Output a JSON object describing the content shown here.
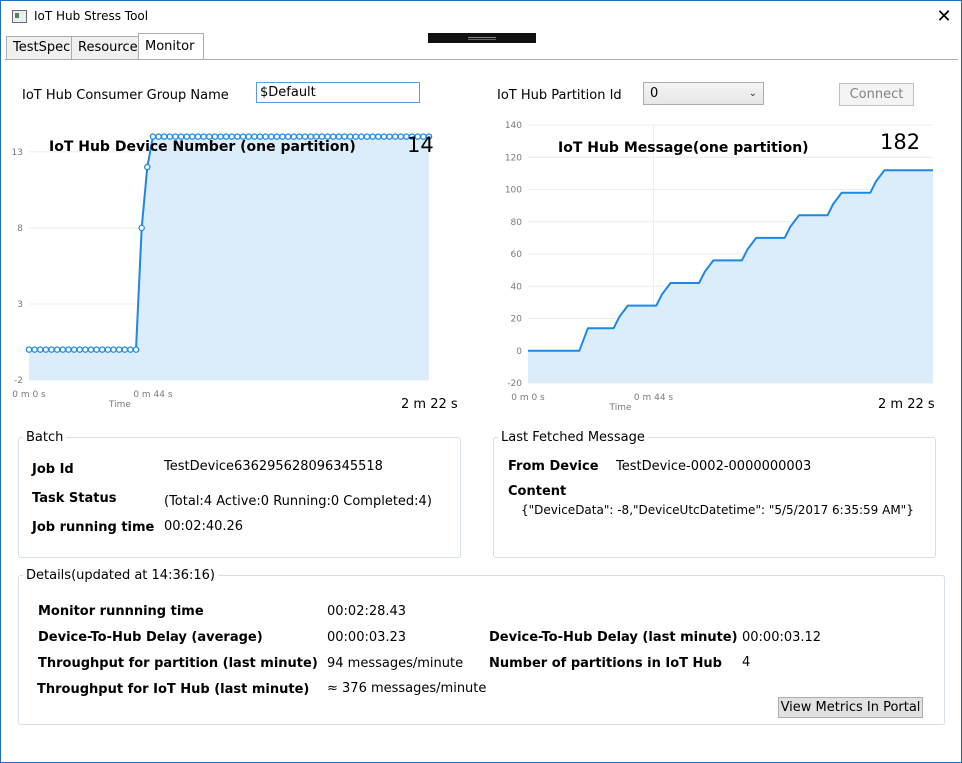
{
  "window": {
    "title": "IoT Hub Stress Tool",
    "close_glyph": "✕"
  },
  "tabs": [
    {
      "label": "TestSpec"
    },
    {
      "label": "Resource"
    },
    {
      "label": "Monitor"
    }
  ],
  "form": {
    "consumer_group_label": "IoT Hub Consumer Group Name",
    "consumer_group_value": "$Default",
    "partition_label": "IoT Hub Partition Id",
    "partition_value": "0",
    "connect_label": "Connect"
  },
  "chart_data": [
    {
      "type": "line",
      "title": "IoT Hub Device Number (one partition)",
      "current_value": "14",
      "xlabel": "Time",
      "x_ticks": [
        "0 m 0 s",
        "0 m 44 s"
      ],
      "x_end_label": "2 m 22 s",
      "ylim": [
        -2,
        14.5
      ],
      "y_ticks": [
        -2,
        3,
        8,
        13
      ],
      "x_range_s": [
        0,
        142
      ],
      "series": [
        {
          "x": [
            0,
            2,
            4,
            6,
            8,
            10,
            12,
            14,
            16,
            18,
            20,
            22,
            24,
            26,
            28,
            30,
            32,
            34,
            36,
            38,
            40,
            42,
            44,
            46,
            48,
            50,
            52,
            54,
            56,
            58,
            60,
            62,
            64,
            66,
            68,
            70,
            72,
            74,
            76,
            78,
            80,
            82,
            84,
            86,
            88,
            90,
            92,
            94,
            96,
            98,
            100,
            102,
            104,
            106,
            108,
            110,
            112,
            114,
            116,
            118,
            120,
            122,
            124,
            126,
            128,
            130,
            132,
            134,
            136,
            138,
            140,
            142
          ],
          "y": [
            0,
            0,
            0,
            0,
            0,
            0,
            0,
            0,
            0,
            0,
            0,
            0,
            0,
            0,
            0,
            0,
            0,
            0,
            0,
            0,
            8,
            12,
            14,
            14,
            14,
            14,
            14,
            14,
            14,
            14,
            14,
            14,
            14,
            14,
            14,
            14,
            14,
            14,
            14,
            14,
            14,
            14,
            14,
            14,
            14,
            14,
            14,
            14,
            14,
            14,
            14,
            14,
            14,
            14,
            14,
            14,
            14,
            14,
            14,
            14,
            14,
            14,
            14,
            14,
            14,
            14,
            14,
            14,
            14,
            14,
            14,
            14
          ]
        }
      ],
      "markers": true
    },
    {
      "type": "area",
      "title": "IoT Hub Message(one partition)",
      "current_value": "182",
      "xlabel": "Time",
      "x_ticks": [
        "0 m 0 s",
        "0 m 44 s"
      ],
      "x_end_label": "2 m 22 s",
      "ylim": [
        -20,
        140
      ],
      "y_ticks": [
        -20,
        0,
        20,
        40,
        60,
        80,
        100,
        120,
        140
      ],
      "x_range_s": [
        0,
        142
      ],
      "series": [
        {
          "x": [
            0,
            18,
            21,
            30,
            32,
            35,
            45,
            47,
            50,
            60,
            62,
            65,
            75,
            77,
            80,
            90,
            92,
            95,
            105,
            107,
            110,
            120,
            122,
            125,
            136,
            138,
            142
          ],
          "y": [
            0,
            0,
            14,
            14,
            21,
            28,
            28,
            35,
            42,
            42,
            49,
            56,
            56,
            63,
            70,
            70,
            77,
            84,
            84,
            91,
            98,
            98,
            105,
            112,
            112,
            112,
            112
          ]
        }
      ]
    }
  ],
  "batch": {
    "title": "Batch",
    "job_id_label": "Job Id",
    "job_id_value": "TestDevice636295628096345518",
    "task_status_label": "Task Status",
    "task_status_value": "(Total:4  Active:0  Running:0  Completed:4)",
    "runtime_label": "Job running time",
    "runtime_value": "00:02:40.26"
  },
  "last_message": {
    "title": "Last Fetched Message",
    "from_label": "From Device",
    "from_value": "TestDevice-0002-0000000003",
    "content_label": "Content",
    "content_value": "{\"DeviceData\": -8,\"DeviceUtcDatetime\": \"5/5/2017 6:35:59 AM\"}"
  },
  "details": {
    "title": "Details(updated at 14:36:16)",
    "monitor_time_label": "Monitor runnning  time",
    "monitor_time_value": "00:02:28.43",
    "delay_avg_label": "Device-To-Hub Delay (average)",
    "delay_avg_value": "00:00:03.23",
    "throughput_partition_label": "Throughput for partition (last minute)",
    "throughput_partition_value": "94 messages/minute",
    "throughput_hub_label": "Throughput for IoT Hub (last minute)",
    "throughput_hub_value": "≈ 376  messages/minute",
    "delay_last_label": "Device-To-Hub Delay (last minute)",
    "delay_last_value": "00:00:03.12",
    "partitions_label": "Number of partitions in IoT Hub",
    "partitions_value": "4",
    "metrics_button": "View Metrics In Portal"
  },
  "colors": {
    "accent": "#1e88e5",
    "fill": "#dbecfb",
    "window_border": "#1f6fb6"
  }
}
